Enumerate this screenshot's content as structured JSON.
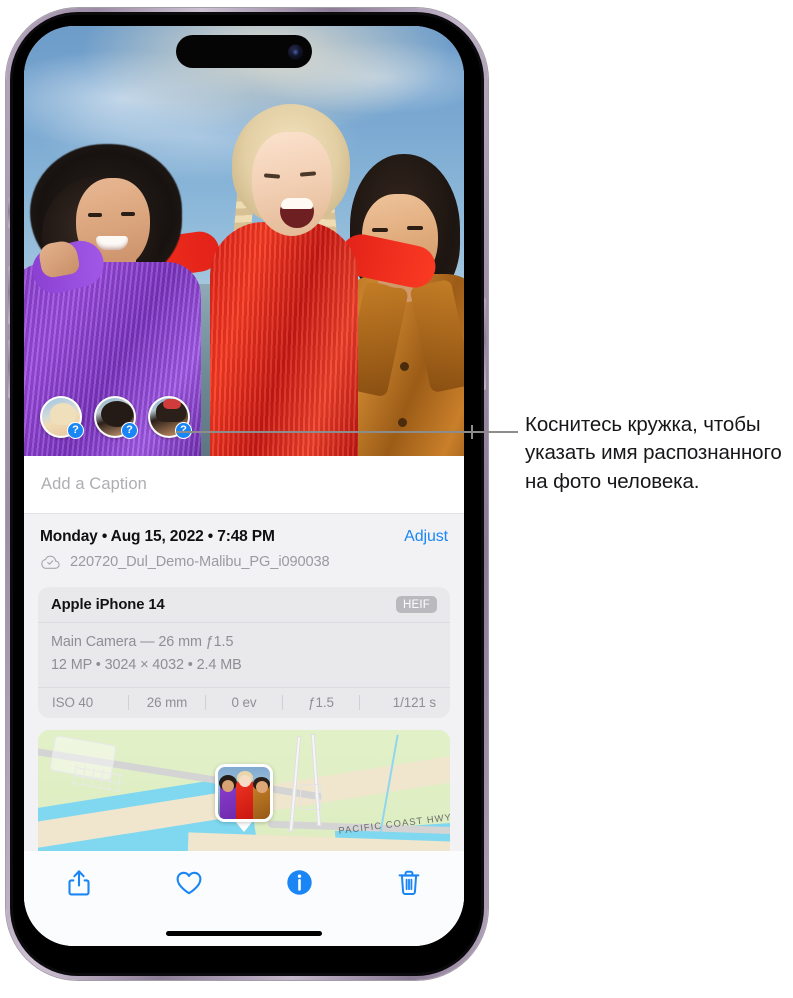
{
  "callout": {
    "text": "Коснитесь кружка, чтобы указать имя распознанного на фото человека."
  },
  "photo": {
    "alt": "Three women laughing together at the beach at sunset",
    "face_circles": [
      {
        "id": "face-1",
        "badge": "?",
        "person": "blonde-woman"
      },
      {
        "id": "face-2",
        "badge": "?",
        "person": "curly-hair-woman"
      },
      {
        "id": "face-3",
        "badge": "?",
        "person": "woman-with-red-headband"
      }
    ]
  },
  "caption": {
    "placeholder": "Add a Caption",
    "value": ""
  },
  "meta": {
    "date": "Monday • Aug 15, 2022 • 7:48 PM",
    "adjust_label": "Adjust",
    "filename": "220720_Dul_Demo-Malibu_PG_i090038",
    "cloud_icon": "cloud-check-icon"
  },
  "exif": {
    "device": "Apple iPhone 14",
    "format_badge": "HEIF",
    "lens_line": "Main Camera — 26 mm ƒ1.5",
    "size_line": "12 MP • 3024 × 4032 • 2.4 MB",
    "stats": [
      "ISO 40",
      "26 mm",
      "0 ev",
      "ƒ1.5",
      "1/121 s"
    ]
  },
  "map": {
    "highway_label": "PACIFIC COAST HWY",
    "pin": "photo-location-pin"
  },
  "toolbar": {
    "items": [
      {
        "name": "share-icon",
        "label": "Share",
        "active": false
      },
      {
        "name": "heart-icon",
        "label": "Favorite",
        "active": false
      },
      {
        "name": "info-icon",
        "label": "Info",
        "active": true
      },
      {
        "name": "trash-icon",
        "label": "Delete",
        "active": false
      }
    ]
  },
  "colors": {
    "accent_blue": "#1a86f5",
    "panel_bg": "#f2f2f5",
    "card_bg": "#e9e9ec",
    "muted_text": "#8e8e95"
  }
}
